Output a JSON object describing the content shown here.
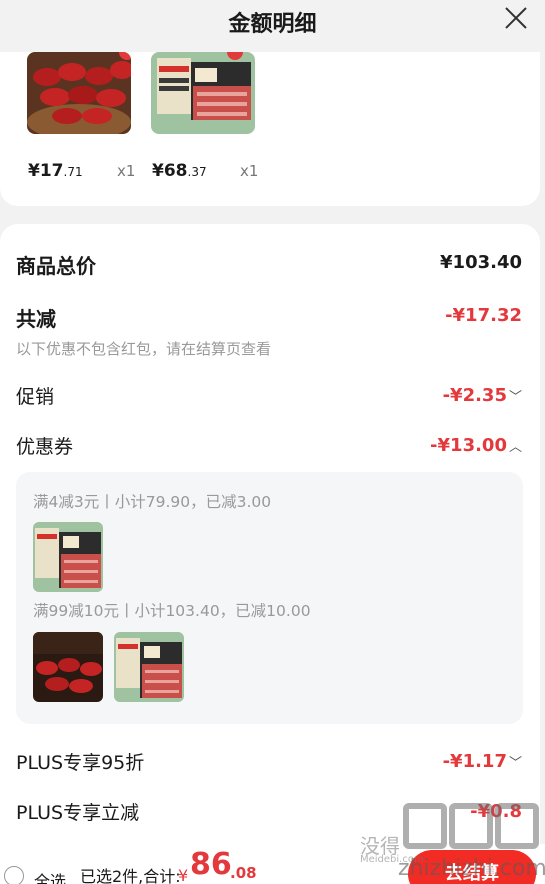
{
  "header": {
    "title": "金额明细",
    "close_icon": "close-icon"
  },
  "products": [
    {
      "price_main": "¥17",
      "price_dec": ".71",
      "qty": "x1",
      "image": "sausage-image"
    },
    {
      "price_main": "¥68",
      "price_dec": ".37",
      "qty": "x1",
      "image": "meat-pack-image"
    }
  ],
  "summary": {
    "total_label": "商品总价",
    "total_value": "¥103.40",
    "reduce_label": "共减",
    "reduce_value": "-¥17.32",
    "reduce_note": "以下优惠不包含红包，请在结算页查看",
    "promo_label": "促销",
    "promo_value": "-¥2.35",
    "coupon_label": "优惠券",
    "coupon_value": "-¥13.00",
    "plus95_label": "PLUS专享95折",
    "plus95_value": "-¥1.17",
    "plusreduce_label": "PLUS专享立减",
    "plusreduce_value": "-¥0.8"
  },
  "coupons": [
    {
      "text": "满4减3元丨小计79.90，已减3.00"
    },
    {
      "text": "满99减10元丨小计103.40，已减10.00"
    }
  ],
  "bottom": {
    "select_all": "全选",
    "selected_summary": "已选2件,合计:",
    "currency": "¥",
    "total_int": "86",
    "total_dec": ".08",
    "checkout_label": "去结算"
  },
  "watermark": {
    "text_cn": "没得",
    "text_en": "Meidebi.com",
    "text_site": "zhizhizhi.com"
  },
  "colors": {
    "accent_red": "#e4393c",
    "button_red": "#f22b25"
  }
}
